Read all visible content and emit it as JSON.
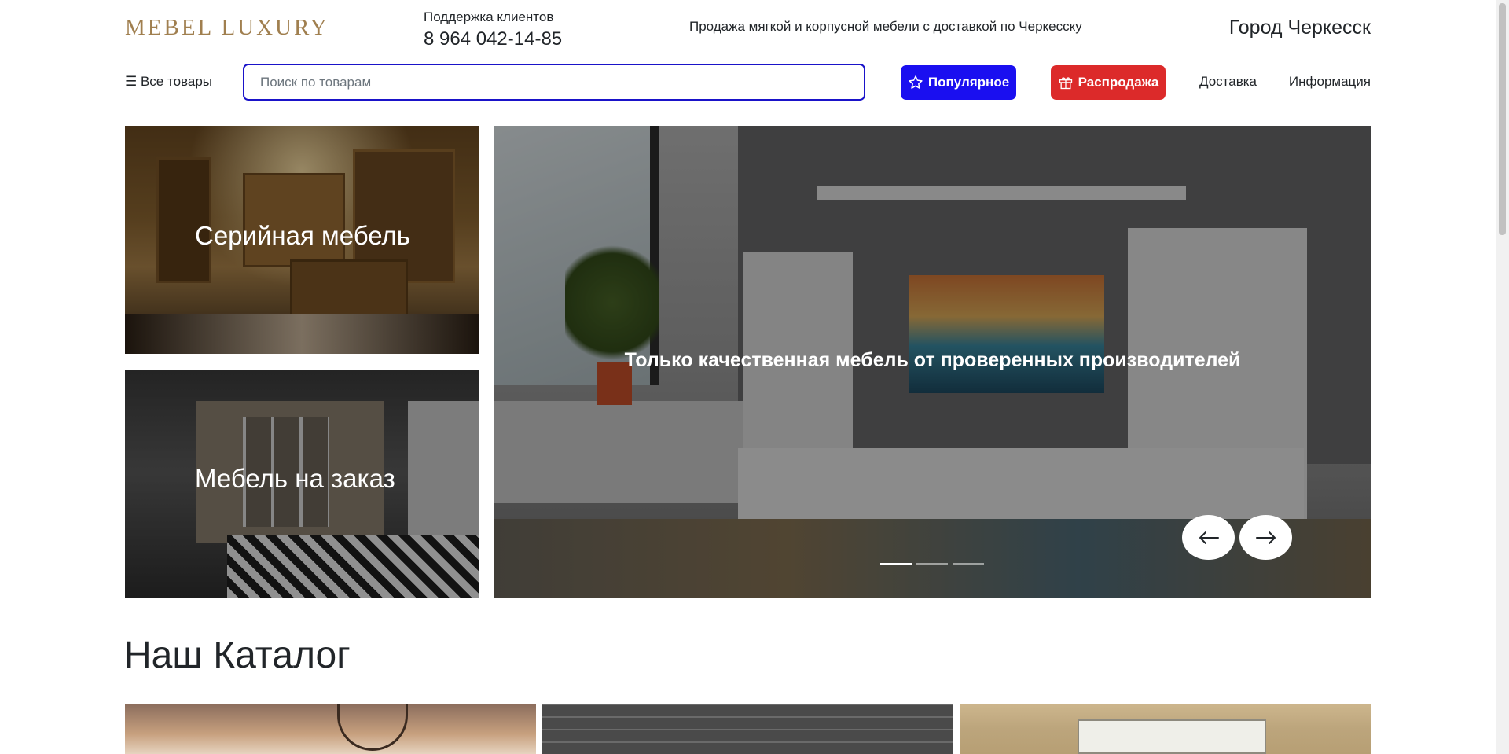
{
  "header": {
    "logo": "MEBEL LUXURY",
    "support_label": "Поддержка клиентов",
    "support_phone": "8 964 042-14-85",
    "tagline": "Продажа мягкой и корпусной мебели с доставкой по Черкесску",
    "city": "Город Черкесск"
  },
  "nav": {
    "all_goods": "☰ Все товары",
    "search_placeholder": "Поиск по товарам",
    "search_value": "",
    "popular": "Популярное",
    "sale": "Распродажа",
    "delivery": "Доставка",
    "info": "Информация",
    "colors": {
      "popular": "#1a0ff0",
      "sale": "#dc2a2a",
      "search_border": "#1a13c9"
    }
  },
  "tiles": [
    {
      "label": "Серийная мебель",
      "icon": "kitchen-photo"
    },
    {
      "label": "Мебель на заказ",
      "icon": "wardrobe-photo"
    }
  ],
  "slider": {
    "caption": "Только качественная мебель от проверенных производителей",
    "slide_count": 3,
    "active_index": 0,
    "prev_icon": "arrow-left-icon",
    "next_icon": "arrow-right-icon"
  },
  "catalog": {
    "title": "Наш Каталог",
    "cards": [
      {
        "icon": "living-room-photo"
      },
      {
        "icon": "brick-wall-photo"
      },
      {
        "icon": "white-cabinet-photo"
      }
    ]
  },
  "brand": {
    "logo_color": "#a07f4f"
  }
}
